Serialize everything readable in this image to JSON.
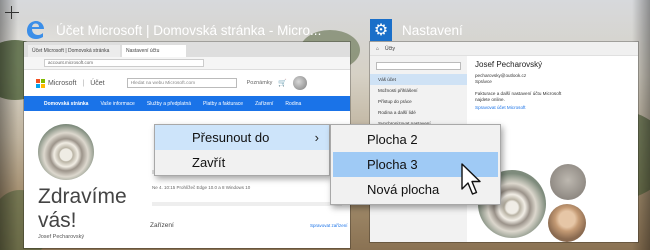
{
  "windows": {
    "edge": {
      "title": "Účet Microsoft | Domovská stránka - Micro...",
      "tabs": [
        "Účet Microsoft | Domovská stránka",
        "Nastavení účtu"
      ],
      "address": "account.microsoft.com",
      "header": {
        "brand": "Microsoft",
        "section": "Účet",
        "search_placeholder": "Hledat na webu Microsoft.com",
        "profile": "Poznámky"
      },
      "nav": [
        "Domovská stránka",
        "Vaše informace",
        "Služby a předplatná",
        "Platby a fakturace",
        "Zařízení",
        "Rodina"
      ],
      "greeting": "Zdravíme vás!",
      "user_name": "Josef Pecharovský",
      "row_text": "Ne 4. 10:15   Prohlížeč Edge 10.0 a 8 Windows 10",
      "devices_heading": "Zařízení",
      "devices_link": "Spravovat zařízení"
    },
    "settings": {
      "title": "Nastavení",
      "top_label": "Účty",
      "sidebar": [
        "Váš účet",
        "Možnosti přihlášení",
        "Přístup do práce",
        "Rodina a další lidé",
        "Synchronizovat nastavení"
      ],
      "name": "Josef Pecharovský",
      "email": "pecharovsky@outlook.cz",
      "role": "Správce",
      "description": "Fakturace a další nastavení účtu Microsoft najdete online.",
      "link": "Spravovat účet Microsoft"
    }
  },
  "context_menu": {
    "items": [
      "Přesunout do",
      "Zavřít"
    ]
  },
  "submenu": {
    "items": [
      "Plocha 2",
      "Plocha 3",
      "Nová plocha"
    ]
  },
  "colors": {
    "edge_blue": "#1a73e8",
    "menu_highlight": "#cde4fa",
    "submenu_highlight": "#9fcaf5",
    "settings_gear_bg": "#1a6fc9"
  }
}
